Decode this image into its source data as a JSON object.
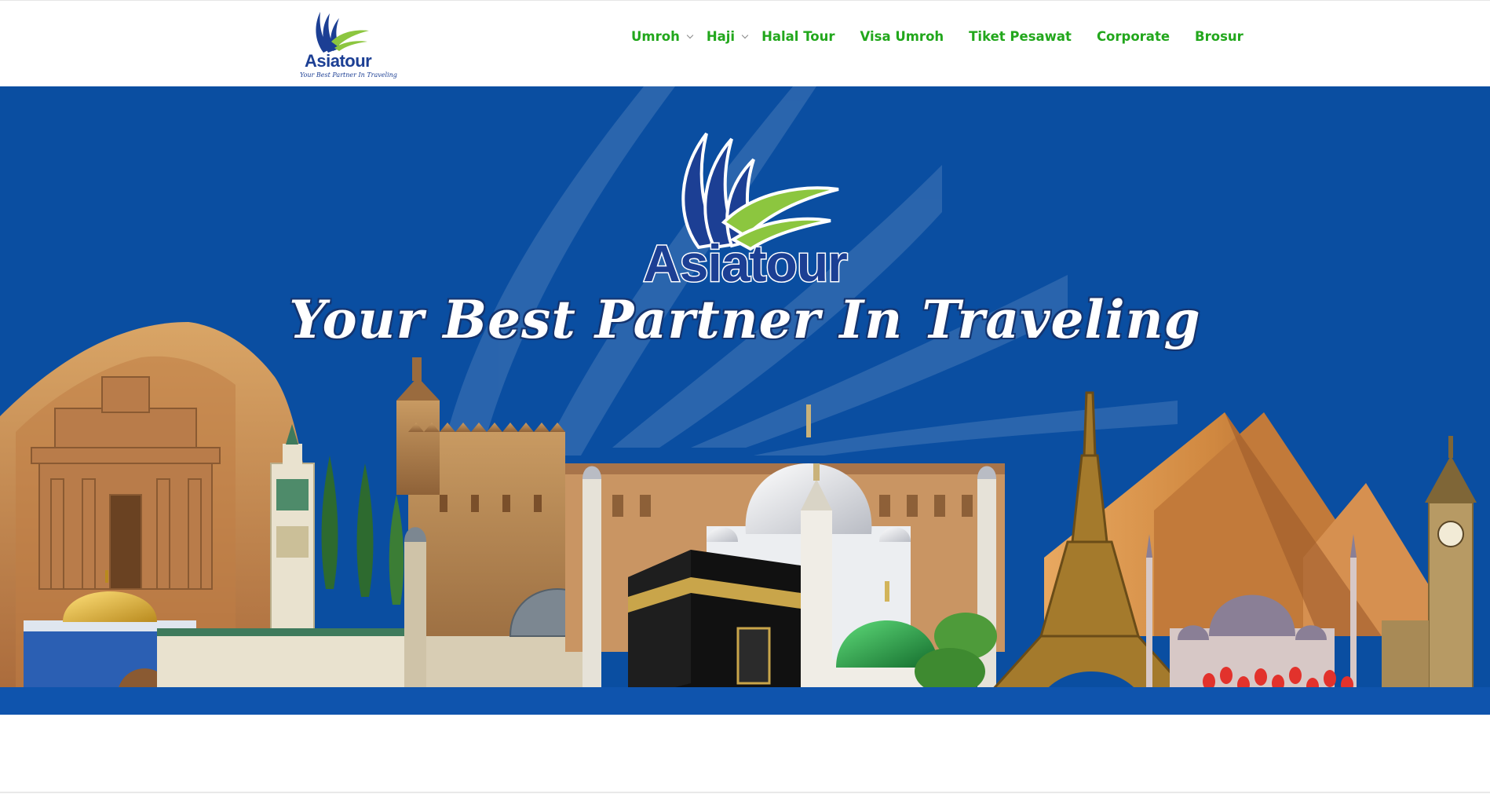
{
  "brand": {
    "name": "Asiatour",
    "tagline": "Your Best Partner In Traveling"
  },
  "nav": {
    "items": [
      {
        "label": "Umroh",
        "has_submenu": true
      },
      {
        "label": "Haji",
        "has_submenu": true
      },
      {
        "label": "Halal Tour",
        "has_submenu": false
      },
      {
        "label": "Visa Umroh",
        "has_submenu": false
      },
      {
        "label": "Tiket Pesawat",
        "has_submenu": false
      },
      {
        "label": "Corporate",
        "has_submenu": false
      },
      {
        "label": "Brosur",
        "has_submenu": false
      }
    ]
  },
  "hero": {
    "title": "Asiatour",
    "tagline": "Your Best Partner In Traveling"
  },
  "colors": {
    "nav_text": "#22a71c",
    "hero_background": "#0a4ea1",
    "brand_blue": "#1c3f94",
    "brand_green": "#8cc63f"
  },
  "icons": [
    "asiatour-logo",
    "chevron-down-icon"
  ]
}
